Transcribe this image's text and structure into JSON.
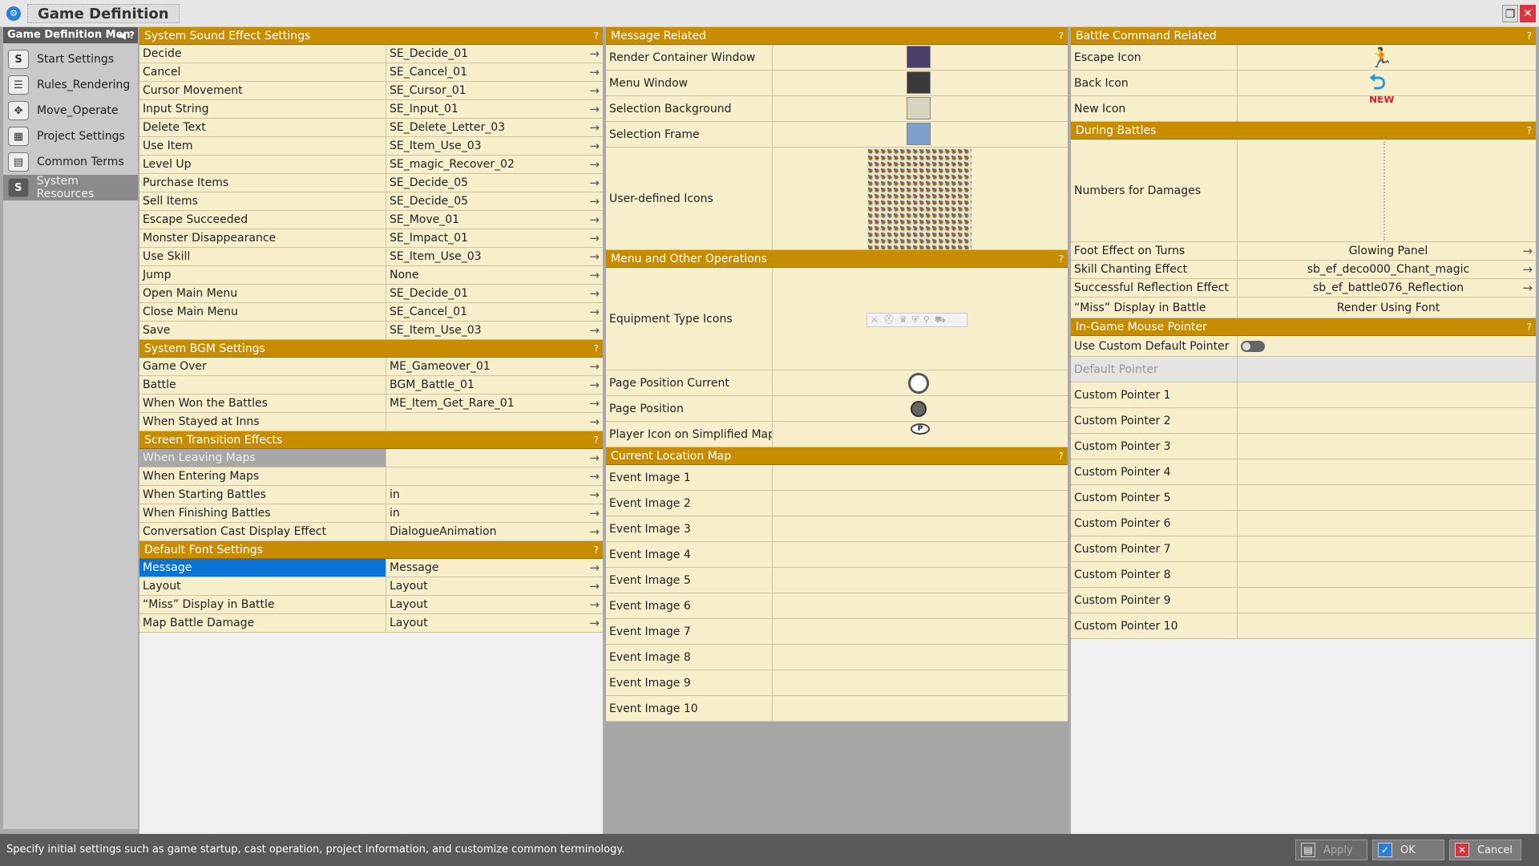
{
  "window": {
    "title": "Game Definition",
    "app_icon": "gear-icon"
  },
  "sidebar": {
    "header": "Game Definition Men",
    "items": [
      {
        "label": "Start Settings",
        "icon": "S"
      },
      {
        "label": "Rules_Rendering",
        "icon": "list-icon"
      },
      {
        "label": "Move_Operate",
        "icon": "gamepad-icon"
      },
      {
        "label": "Project Settings",
        "icon": "grid-icon"
      },
      {
        "label": "Common Terms",
        "icon": "doc-icon"
      },
      {
        "label": "System Resources",
        "icon": "S"
      }
    ]
  },
  "col1": {
    "sound": {
      "title": "System Sound Effect Settings",
      "rows": [
        {
          "label": "Decide",
          "value": "SE_Decide_01"
        },
        {
          "label": "Cancel",
          "value": "SE_Cancel_01"
        },
        {
          "label": "Cursor Movement",
          "value": "SE_Cursor_01"
        },
        {
          "label": "Input String",
          "value": "SE_Input_01"
        },
        {
          "label": "Delete Text",
          "value": "SE_Delete_Letter_03"
        },
        {
          "label": "Use Item",
          "value": "SE_Item_Use_03"
        },
        {
          "label": "Level Up",
          "value": "SE_magic_Recover_02"
        },
        {
          "label": "Purchase Items",
          "value": "SE_Decide_05"
        },
        {
          "label": "Sell Items",
          "value": "SE_Decide_05"
        },
        {
          "label": "Escape Succeeded",
          "value": "SE_Move_01"
        },
        {
          "label": "Monster Disappearance",
          "value": "SE_Impact_01"
        },
        {
          "label": "Use Skill",
          "value": "SE_Item_Use_03"
        },
        {
          "label": "Jump",
          "value": "None"
        },
        {
          "label": "Open Main Menu",
          "value": "SE_Decide_01"
        },
        {
          "label": "Close Main Menu",
          "value": "SE_Cancel_01"
        },
        {
          "label": "Save",
          "value": "SE_Item_Use_03"
        }
      ]
    },
    "bgm": {
      "title": "System BGM Settings",
      "rows": [
        {
          "label": "Game Over",
          "value": "ME_Gameover_01"
        },
        {
          "label": "Battle",
          "value": "BGM_Battle_01"
        },
        {
          "label": "When Won the Battles",
          "value": "ME_Item_Get_Rare_01"
        },
        {
          "label": "When Stayed at Inns",
          "value": ""
        }
      ]
    },
    "transition": {
      "title": "Screen Transition Effects",
      "rows": [
        {
          "label": "When Leaving Maps",
          "value": ""
        },
        {
          "label": "When Entering Maps",
          "value": ""
        },
        {
          "label": "When Starting Battles",
          "value": "in"
        },
        {
          "label": "When Finishing Battles",
          "value": "in"
        },
        {
          "label": "Conversation Cast Display Effect",
          "value": "DialogueAnimation"
        }
      ]
    },
    "font": {
      "title": "Default Font Settings",
      "rows": [
        {
          "label": "Message",
          "value": "Message"
        },
        {
          "label": "Layout",
          "value": "Layout"
        },
        {
          "label": "“Miss” Display in Battle",
          "value": "Layout"
        },
        {
          "label": "Map Battle Damage",
          "value": "Layout"
        }
      ]
    }
  },
  "col2": {
    "message": {
      "title": "Message Related",
      "rows": [
        {
          "label": "Render Container Window",
          "color": "#4a3f6b"
        },
        {
          "label": "Menu Window",
          "color": "#3a3a3a"
        },
        {
          "label": "Selection Background",
          "color": "#d8d3bd"
        },
        {
          "label": "Selection Frame",
          "color": "#7d9fcc"
        }
      ],
      "icons_label": "User-defined Icons"
    },
    "menu": {
      "title": "Menu and Other Operations",
      "rows": [
        {
          "label": "Equipment Type Icons"
        },
        {
          "label": "Page Position Current"
        },
        {
          "label": "Page Position"
        },
        {
          "label": "Player Icon on Simplified Map"
        }
      ]
    },
    "location": {
      "title": "Current Location Map",
      "rows": [
        "Event Image 1",
        "Event Image 2",
        "Event Image 3",
        "Event Image 4",
        "Event Image 5",
        "Event Image 6",
        "Event Image 7",
        "Event Image 8",
        "Event Image 9",
        "Event Image 10"
      ]
    }
  },
  "col3": {
    "battle_cmd": {
      "title": "Battle Command Related",
      "rows": [
        {
          "label": "Escape Icon"
        },
        {
          "label": "Back Icon"
        },
        {
          "label": "New Icon",
          "badge": "NEW"
        }
      ]
    },
    "during": {
      "title": "During Battles",
      "rows": [
        {
          "label": "Numbers for Damages",
          "value": ""
        },
        {
          "label": "Foot Effect on Turns",
          "value": "Glowing Panel"
        },
        {
          "label": "Skill Chanting Effect",
          "value": "sb_ef_deco000_Chant_magic"
        },
        {
          "label": "Successful Reflection Effect",
          "value": "sb_ef_battle076_Reflection"
        },
        {
          "label": "“Miss” Display in Battle",
          "value": "Render Using Font"
        }
      ]
    },
    "mouse": {
      "title": "In-Game Mouse Pointer",
      "toggle_label": "Use Custom Default Pointer",
      "default_label": "Default Pointer",
      "rows": [
        "Custom Pointer 1",
        "Custom Pointer 2",
        "Custom Pointer 3",
        "Custom Pointer 4",
        "Custom Pointer 5",
        "Custom Pointer 6",
        "Custom Pointer 7",
        "Custom Pointer 8",
        "Custom Pointer 9",
        "Custom Pointer 10"
      ]
    }
  },
  "status": {
    "text": "Specify initial settings such as game startup, cast operation, project information, and customize common terminology.",
    "apply": "Apply",
    "ok": "OK",
    "cancel": "Cancel"
  }
}
